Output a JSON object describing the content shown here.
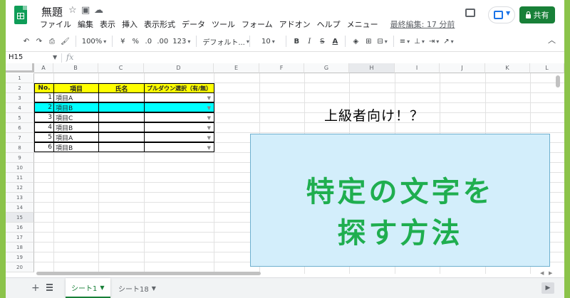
{
  "header": {
    "title": "無題",
    "menu": [
      "ファイル",
      "編集",
      "表示",
      "挿入",
      "表示形式",
      "データ",
      "ツール",
      "フォーム",
      "アドオン",
      "ヘルプ",
      "メニュー"
    ],
    "last_edit": "最終編集: 17 分前",
    "share_label": "共有"
  },
  "toolbar": {
    "zoom": "100%",
    "currency": "¥",
    "percent": "%",
    "decimal_dec": ".0",
    "decimal_inc": ".00",
    "number_format": "123",
    "font": "デフォルト...",
    "font_size": "10",
    "bold": "B",
    "italic": "I",
    "strike": "S",
    "text_color": "A"
  },
  "formula_bar": {
    "name_box": "H15",
    "fx": "fx"
  },
  "grid": {
    "columns": [
      "A",
      "B",
      "C",
      "D",
      "E",
      "F",
      "G",
      "H",
      "I",
      "J",
      "K",
      "L"
    ],
    "selected_column": "H",
    "rows": [
      "1",
      "2",
      "3",
      "4",
      "5",
      "6",
      "7",
      "8",
      "9",
      "10",
      "11",
      "12",
      "13",
      "14",
      "15",
      "16",
      "17",
      "18",
      "19",
      "20"
    ],
    "selected_row": "15"
  },
  "table": {
    "headers": [
      "No.",
      "項目",
      "氏名",
      "プルダウン選択（有/無）"
    ],
    "rows": [
      {
        "no": "1",
        "item": "項目A",
        "name": ""
      },
      {
        "no": "2",
        "item": "項目B",
        "name": ""
      },
      {
        "no": "3",
        "item": "項目C",
        "name": ""
      },
      {
        "no": "4",
        "item": "項目B",
        "name": ""
      },
      {
        "no": "5",
        "item": "項目A",
        "name": ""
      },
      {
        "no": "6",
        "item": "項目B",
        "name": ""
      }
    ],
    "highlight_color": "#00ffff",
    "header_color": "#ffff00"
  },
  "overlay": {
    "caption": "上級者向け！？",
    "line1": "特定の文字を",
    "line2": "探す方法",
    "box_color": "#d3eefb",
    "text_color": "#1fae4f"
  },
  "sheets": {
    "tabs": [
      "シート1",
      "シート18"
    ],
    "active": "シート1"
  },
  "colors": {
    "frame_background": "#8bc34a",
    "brand_green": "#188038"
  }
}
